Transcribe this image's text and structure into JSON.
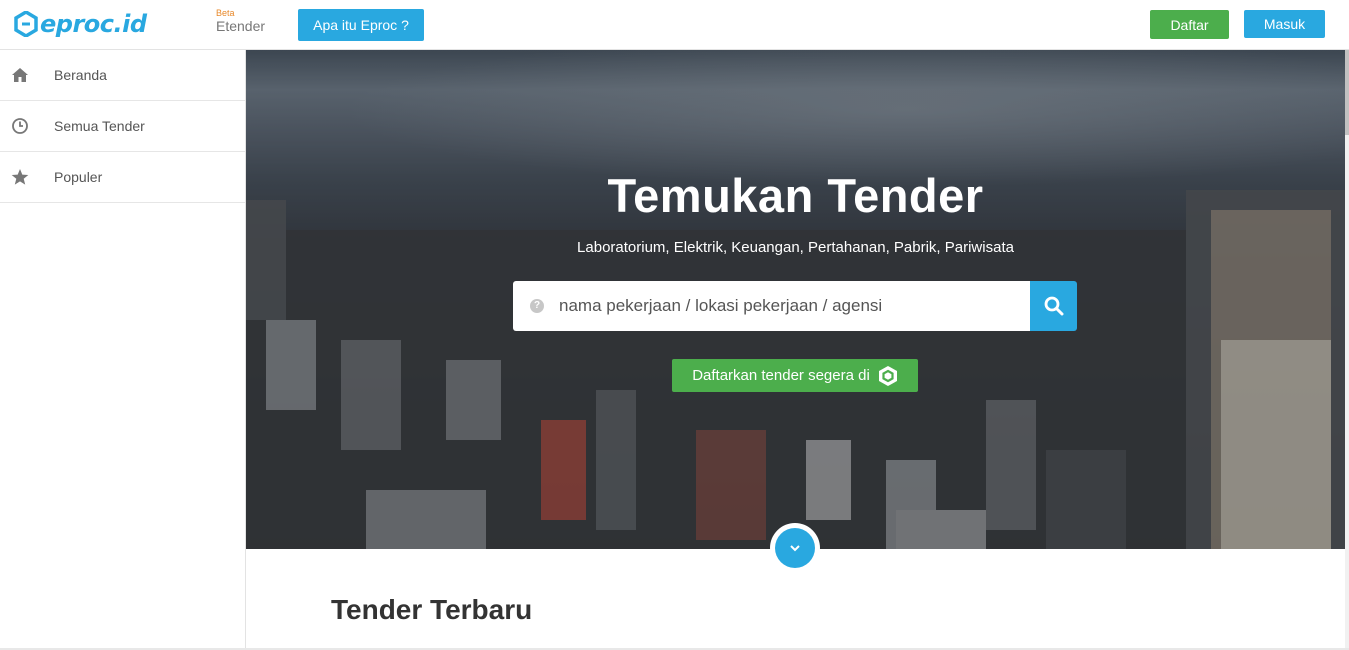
{
  "header": {
    "logo_text": "eproc.id",
    "beta_label": "Beta",
    "product_label": "Etender",
    "what_button": "Apa itu Eproc ?",
    "register_button": "Daftar",
    "login_button": "Masuk"
  },
  "sidebar": {
    "items": [
      {
        "label": "Beranda",
        "icon": "home-icon"
      },
      {
        "label": "Semua Tender",
        "icon": "clock-icon"
      },
      {
        "label": "Populer",
        "icon": "star-icon"
      }
    ]
  },
  "hero": {
    "title": "Temukan Tender",
    "subtitle": "Laboratorium, Elektrik, Keuangan, Pertahanan, Pabrik, Pariwisata",
    "search_placeholder": "nama pekerjaan / lokasi pekerjaan / agensi",
    "cta_label": "Daftarkan tender segera di"
  },
  "main": {
    "section_title": "Tender Terbaru"
  },
  "colors": {
    "primary": "#29a8e0",
    "success": "#4cae4c",
    "beta": "#e8892b"
  }
}
